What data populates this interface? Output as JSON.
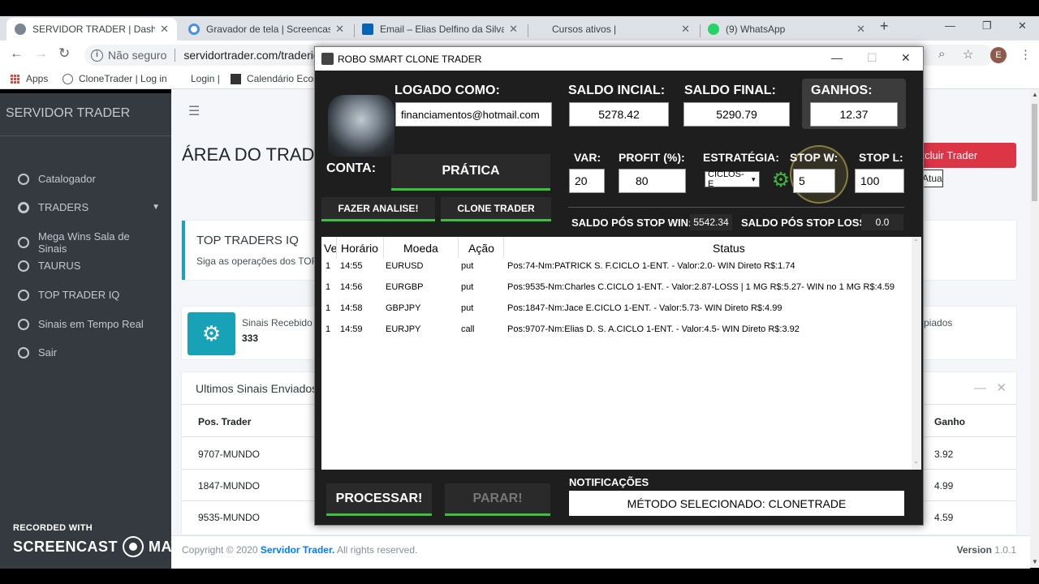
{
  "browser": {
    "tabs": [
      {
        "title": "SERVIDOR TRADER | Dashboar",
        "color": "#7a8793"
      },
      {
        "title": "Gravador de tela | Screencast-",
        "color": "#4a90e2"
      },
      {
        "title": "Email – Elias Delfino da Silva N",
        "color": "#0364b8"
      },
      {
        "title": "Cursos ativos |",
        "color": "#dee1e6"
      },
      {
        "title": "(9) WhatsApp",
        "color": "#25d366"
      }
    ],
    "security_label": "Não seguro",
    "url": "servidortrader.com/traderiq.p",
    "avatar_letter": "E",
    "bookmarks": [
      "Apps",
      "CloneTrader | Log in",
      "Login |",
      "Calendário Econ"
    ]
  },
  "site": {
    "brand": "SERVIDOR TRADER",
    "menu": [
      "Catalogador",
      "TRADERS",
      "Mega Wins Sala de Sinais",
      "TAURUS",
      "TOP TRADER IQ",
      "Sinais em Tempo Real",
      "Sair"
    ],
    "page_title": "ÁREA DO TRADE",
    "red_button": "Excluir Trader",
    "small_button": "Atualizar",
    "card_title": "TOP TRADERS IQ",
    "card_subtitle": "Siga as operações dos TOF",
    "infobox_label": "Sinais Recebido",
    "infobox_value": "333",
    "infobox_right": "piados",
    "table_title": "Ultimos Sinais Enviados",
    "table_headers": {
      "pos": "Pos. Trader",
      "ganho": "Ganho"
    },
    "table_rows": [
      {
        "pos": "9707-MUNDO",
        "ganho": "3.92"
      },
      {
        "pos": "1847-MUNDO",
        "ganho": "4.99"
      },
      {
        "pos": "9535-MUNDO",
        "ganho": "4.59"
      }
    ],
    "footer_left_prefix": "Copyright © 2020",
    "footer_brand": "Servidor Trader.",
    "footer_left_suffix": "All rights reserved.",
    "footer_version_label": "Version",
    "footer_version": "1.0.1"
  },
  "screencast": {
    "recorded": "RECORDED WITH",
    "left": "SCREENCAST",
    "right": "MATIC"
  },
  "app": {
    "title": "ROBO SMART CLONE TRADER",
    "logado_label": "LOGADO COMO:",
    "email": "financiamentos@hotmail.com",
    "saldo_inicial_label": "SALDO INCIAL:",
    "saldo_inicial": "5278.42",
    "saldo_final_label": "SALDO FINAL:",
    "saldo_final": "5290.79",
    "ganhos_label": "GANHOS:",
    "ganhos": "12.37",
    "conta_label": "CONTA:",
    "conta_value": "PRÁTICA",
    "var_label": "VAR:",
    "var_value": "20",
    "profit_label": "PROFIT (%):",
    "profit_value": "80",
    "estrategia_label": "ESTRATÉGIA:",
    "estrategia_value": "CICLOS-E",
    "stopw_label": "STOP W:",
    "stopw_value": "5",
    "stopl_label": "STOP L:",
    "stopl_value": "100",
    "btn_analise": "FAZER ANALISE!",
    "btn_clone": "CLONE TRADER",
    "saldo_pos_win_label": "SALDO PÓS STOP WIN:",
    "saldo_pos_win": "5542.34",
    "saldo_pos_loss_label": "SALDO PÓS STOP LOSS:",
    "saldo_pos_loss": "0.0",
    "grid_headers": {
      "ve": "Ve",
      "horario": "Horário",
      "moeda": "Moeda",
      "acao": "Ação",
      "status": "Status"
    },
    "grid_rows": [
      {
        "ve": "1",
        "horario": "14:55",
        "moeda": "EURUSD",
        "acao": "put",
        "status": "Pos:74-Nm:PATRICK S. F.CICLO 1-ENT. - Valor:2.0- WIN Direto R$:1.74"
      },
      {
        "ve": "1",
        "horario": "14:56",
        "moeda": "EURGBP",
        "acao": "put",
        "status": "Pos:9535-Nm:Charles C.CICLO 1-ENT. - Valor:2.87-LOSS | 1 MG R$:5.27- WIN no 1 MG R$:4.59"
      },
      {
        "ve": "1",
        "horario": "14:58",
        "moeda": "GBPJPY",
        "acao": "put",
        "status": "Pos:1847-Nm:Jace E.CICLO 1-ENT. - Valor:5.73- WIN Direto R$:4.99"
      },
      {
        "ve": "1",
        "horario": "14:59",
        "moeda": "EURJPY",
        "acao": "call",
        "status": "Pos:9707-Nm:Elias D. S. A.CICLO 1-ENT. - Valor:4.5- WIN Direto R$:3.92"
      }
    ],
    "btn_processar": "PROCESSAR!",
    "btn_parar": "PARAR!",
    "notif_label": "NOTIFICAÇÕES",
    "notif_text": "MÉTODO SELECIONADO: CLONETRADE"
  }
}
